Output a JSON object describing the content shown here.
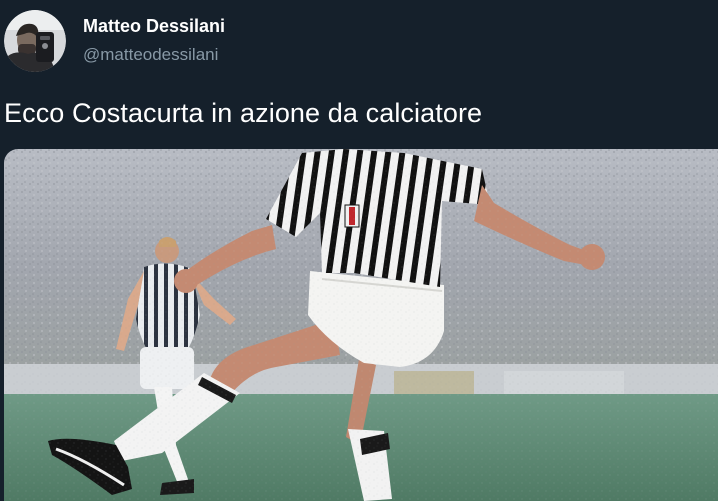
{
  "user": {
    "name": "Matteo Dessilani",
    "handle": "@matteodessilani",
    "avatar_icon": "user-avatar-photo"
  },
  "tweet": {
    "text": "Ecco Costacurta in azione da calciatore"
  },
  "media": {
    "kind": "photo",
    "icon": "football-player-photo"
  },
  "colors": {
    "background": "#15202b",
    "name": "#ffffff",
    "handle": "#8899a6",
    "text": "#ffffff",
    "pitch": "#5f8a74",
    "crowd": "#a7acb5"
  }
}
